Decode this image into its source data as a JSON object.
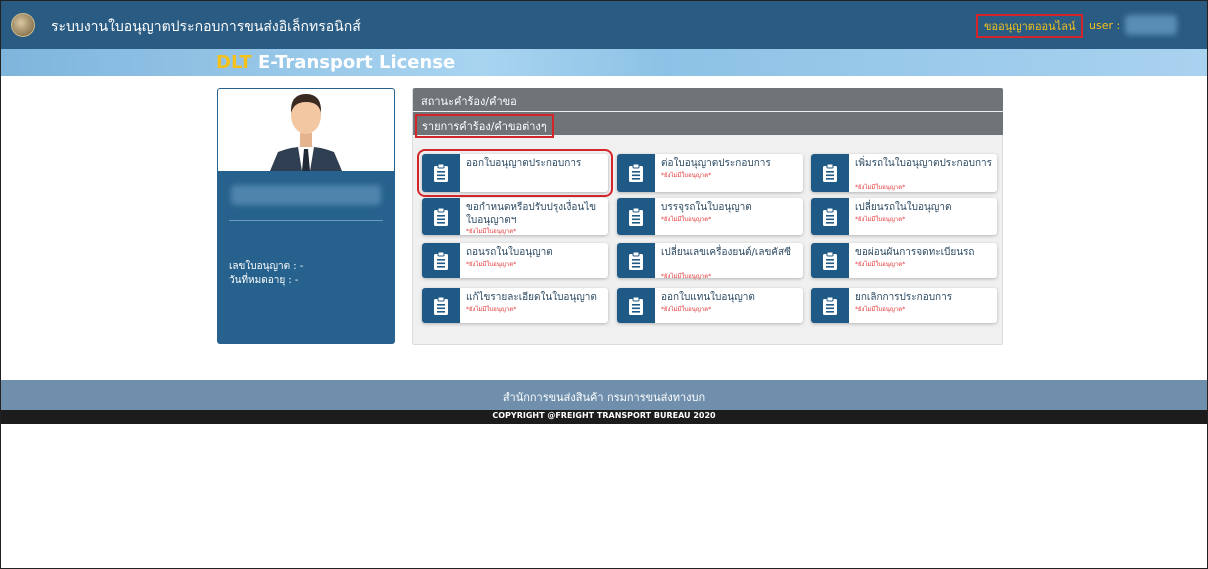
{
  "header": {
    "app_title": "ระบบงานใบอนุญาตประกอบการขนส่งอิเล็กทรอนิกส์",
    "online_link": "ขออนุญาตออนไลน์",
    "user_label": "user :"
  },
  "banner": {
    "prefix": "DLT",
    "title": "E-Transport License"
  },
  "profile": {
    "license_no": "เลขใบอนุญาต : -",
    "expiry": "วันที่หมดอายุ : -"
  },
  "panel": {
    "status_tab": "สถานะคำร้อง/คำขอ",
    "requests_tab": "รายการคำร้อง/คำขอต่างๆ"
  },
  "services": [
    {
      "title": "ออกใบอนุญาตประกอบการ",
      "note": ""
    },
    {
      "title": "ต่อใบอนุญาตประกอบการ",
      "note": "*ยังไม่มีใบอนุญาต*"
    },
    {
      "title": "เพิ่มรถในใบอนุญาตประกอบการ",
      "note": "*ยังไม่มีใบอนุญาต*"
    },
    {
      "title": "ขอกำหนดหรือปรับปรุงเงื่อนไขใบอนุญาตฯ",
      "note": "*ยังไม่มีใบอนุญาต*"
    },
    {
      "title": "บรรจุรถในใบอนุญาต",
      "note": "*ยังไม่มีใบอนุญาต*"
    },
    {
      "title": "เปลี่ยนรถในใบอนุญาต",
      "note": "*ยังไม่มีใบอนุญาต*"
    },
    {
      "title": "ถอนรถในใบอนุญาต",
      "note": "*ยังไม่มีใบอนุญาต*"
    },
    {
      "title": "เปลี่ยนเลขเครื่องยนต์/เลขคัสซี",
      "note": "*ยังไม่มีใบอนุญาต*"
    },
    {
      "title": "ขอผ่อนผันการจดทะเบียนรถ",
      "note": "*ยังไม่มีใบอนุญาต*"
    },
    {
      "title": "แก้ไขรายละเอียดในใบอนุญาต",
      "note": "*ยังไม่มีใบอนุญาต*"
    },
    {
      "title": "ออกใบแทนใบอนุญาต",
      "note": "*ยังไม่มีใบอนุญาต*"
    },
    {
      "title": "ยกเลิกการประกอบการ",
      "note": "*ยังไม่มีใบอนุญาต*"
    }
  ],
  "footer": {
    "org": "สำนักการขนส่งสินค้า กรมการขนส่งทางบก",
    "copyright": "COPYRIGHT @FREIGHT TRANSPORT BUREAU 2020"
  },
  "colors": {
    "topbar": "#2a5b82",
    "accent_yellow": "#f4c21b",
    "highlight_red": "#d4262a",
    "tab_gray": "#6f7479",
    "icon_blue": "#1f5a86"
  }
}
